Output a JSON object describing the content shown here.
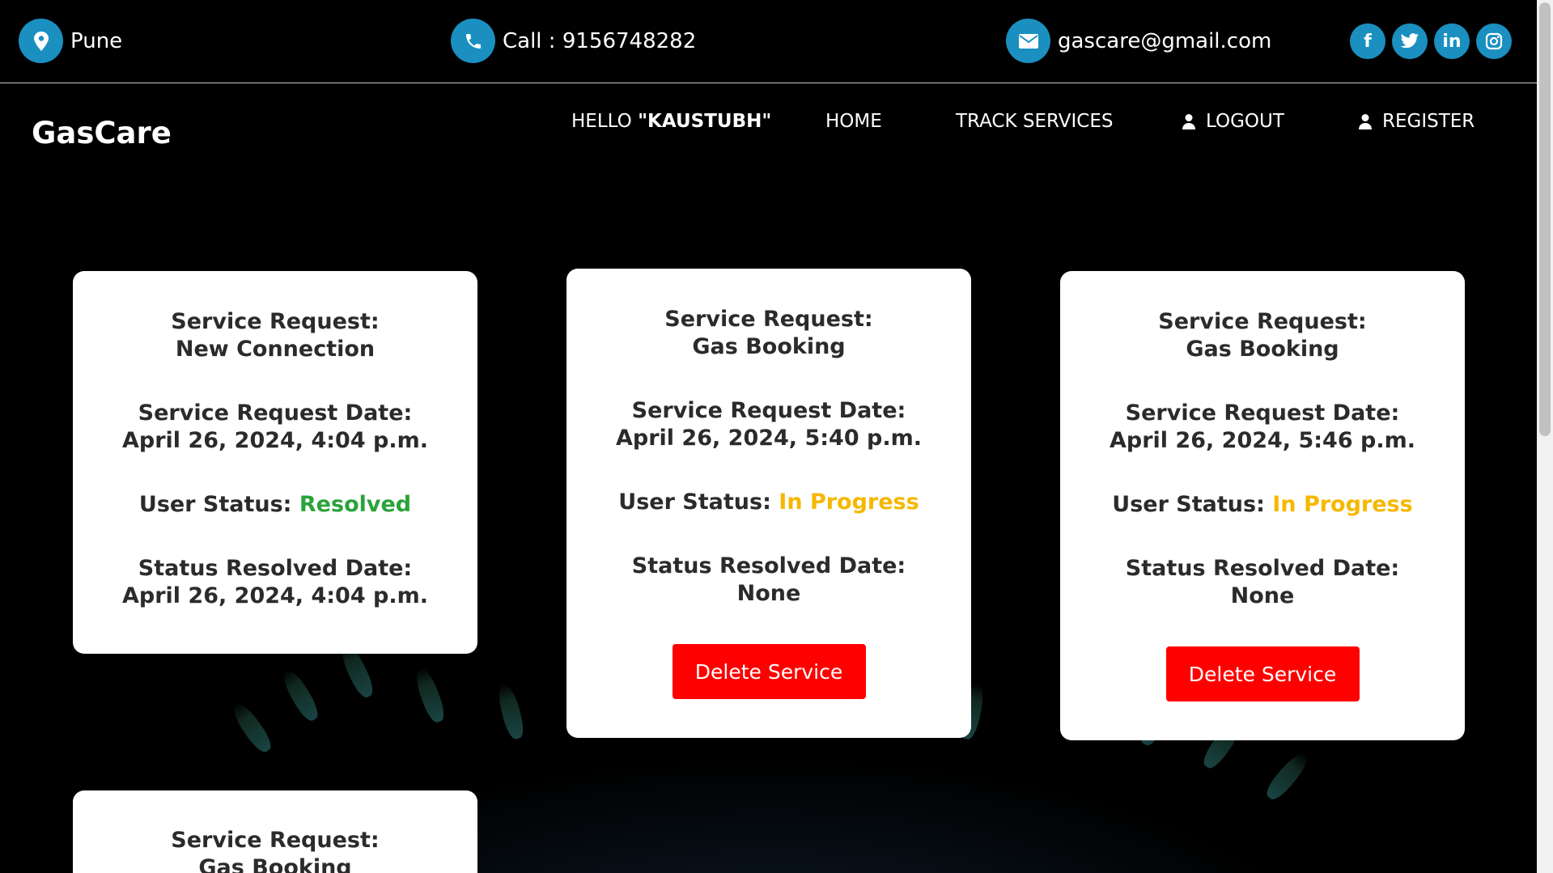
{
  "topbar": {
    "location": "Pune",
    "phone": "Call : 9156748282",
    "email": "gascare@gmail.com",
    "socials": [
      {
        "icon": "facebook-icon",
        "glyph": "f"
      },
      {
        "icon": "twitter-icon",
        "glyph": "t"
      },
      {
        "icon": "linkedin-icon",
        "glyph": "in"
      },
      {
        "icon": "instagram-icon",
        "glyph": "◎"
      }
    ]
  },
  "navbar": {
    "brand": "GasCare",
    "greeting_prefix": "HELLO ",
    "greeting_user": "\"KAUSTUBH\"",
    "home": "HOME",
    "track": "TRACK SERVICES",
    "logout": "LOGOUT",
    "register": "REGISTER"
  },
  "labels": {
    "service_request": "Service Request:",
    "request_date": "Service Request Date:",
    "user_status": "User Status:",
    "resolved_date": "Status Resolved Date:",
    "delete": "Delete Service"
  },
  "cards": [
    {
      "service": "New Connection",
      "date": "April 26, 2024, 4:04 p.m.",
      "status": "Resolved",
      "resolved": "April 26, 2024, 4:04 p.m."
    },
    {
      "service": "Gas Booking",
      "date": "April 26, 2024, 5:40 p.m.",
      "status": "In Progress",
      "resolved": "None"
    },
    {
      "service": "Gas Booking",
      "date": "April 26, 2024, 5:46 p.m.",
      "status": "In Progress",
      "resolved": "None"
    },
    {
      "service": "Gas Booking"
    }
  ],
  "colors": {
    "accent": "#1a8fc0",
    "resolved": "#2aa33a",
    "in_progress": "#f5b800",
    "danger": "#ff0000"
  }
}
